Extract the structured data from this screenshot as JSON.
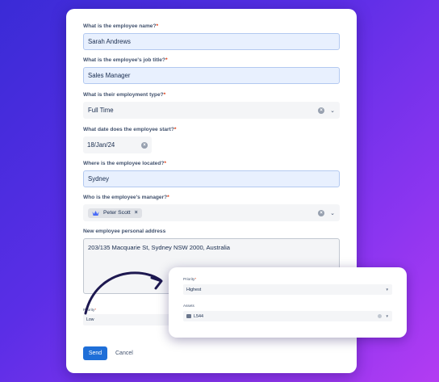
{
  "form": {
    "fields": [
      {
        "label": "What is the employee name?",
        "required": "*",
        "value": "Sarah Andrews"
      },
      {
        "label": "What is the employee's job title?",
        "required": "*",
        "value": "Sales Manager"
      },
      {
        "label": "What is their employment type?",
        "required": "*",
        "value": "Full Time"
      },
      {
        "label": "What date does the employee start?",
        "required": "*",
        "value": "18/Jan/24"
      },
      {
        "label": "Where is the employee located?",
        "required": "*",
        "value": "Sydney"
      },
      {
        "label": "Who is the employee's manager?",
        "required": "*",
        "value": "Peter Scott"
      },
      {
        "label": "New employee personal address",
        "required": "",
        "value": "203/135 Macquarie St, Sydney NSW 2000, Australia"
      }
    ],
    "priority": {
      "label": "Priority",
      "required": "*",
      "value": "Low"
    },
    "send_label": "Send",
    "cancel_label": "Cancel"
  },
  "popup": {
    "priority": {
      "label": "Priority",
      "required": "*",
      "value": "Highest"
    },
    "assets": {
      "label": "Assets",
      "value": "L544"
    }
  },
  "colors": {
    "accent": "#1f6fd8",
    "required": "#de350b",
    "filled_bg": "#e8f0fe",
    "arrow": "#1d1850"
  },
  "icons": {
    "clear": "clear-icon",
    "chevron": "chevron-down-icon",
    "chip_remove": "close-icon",
    "avatar": "avatar-icon",
    "asset": "asset-icon",
    "arrow": "curved-arrow-icon"
  }
}
